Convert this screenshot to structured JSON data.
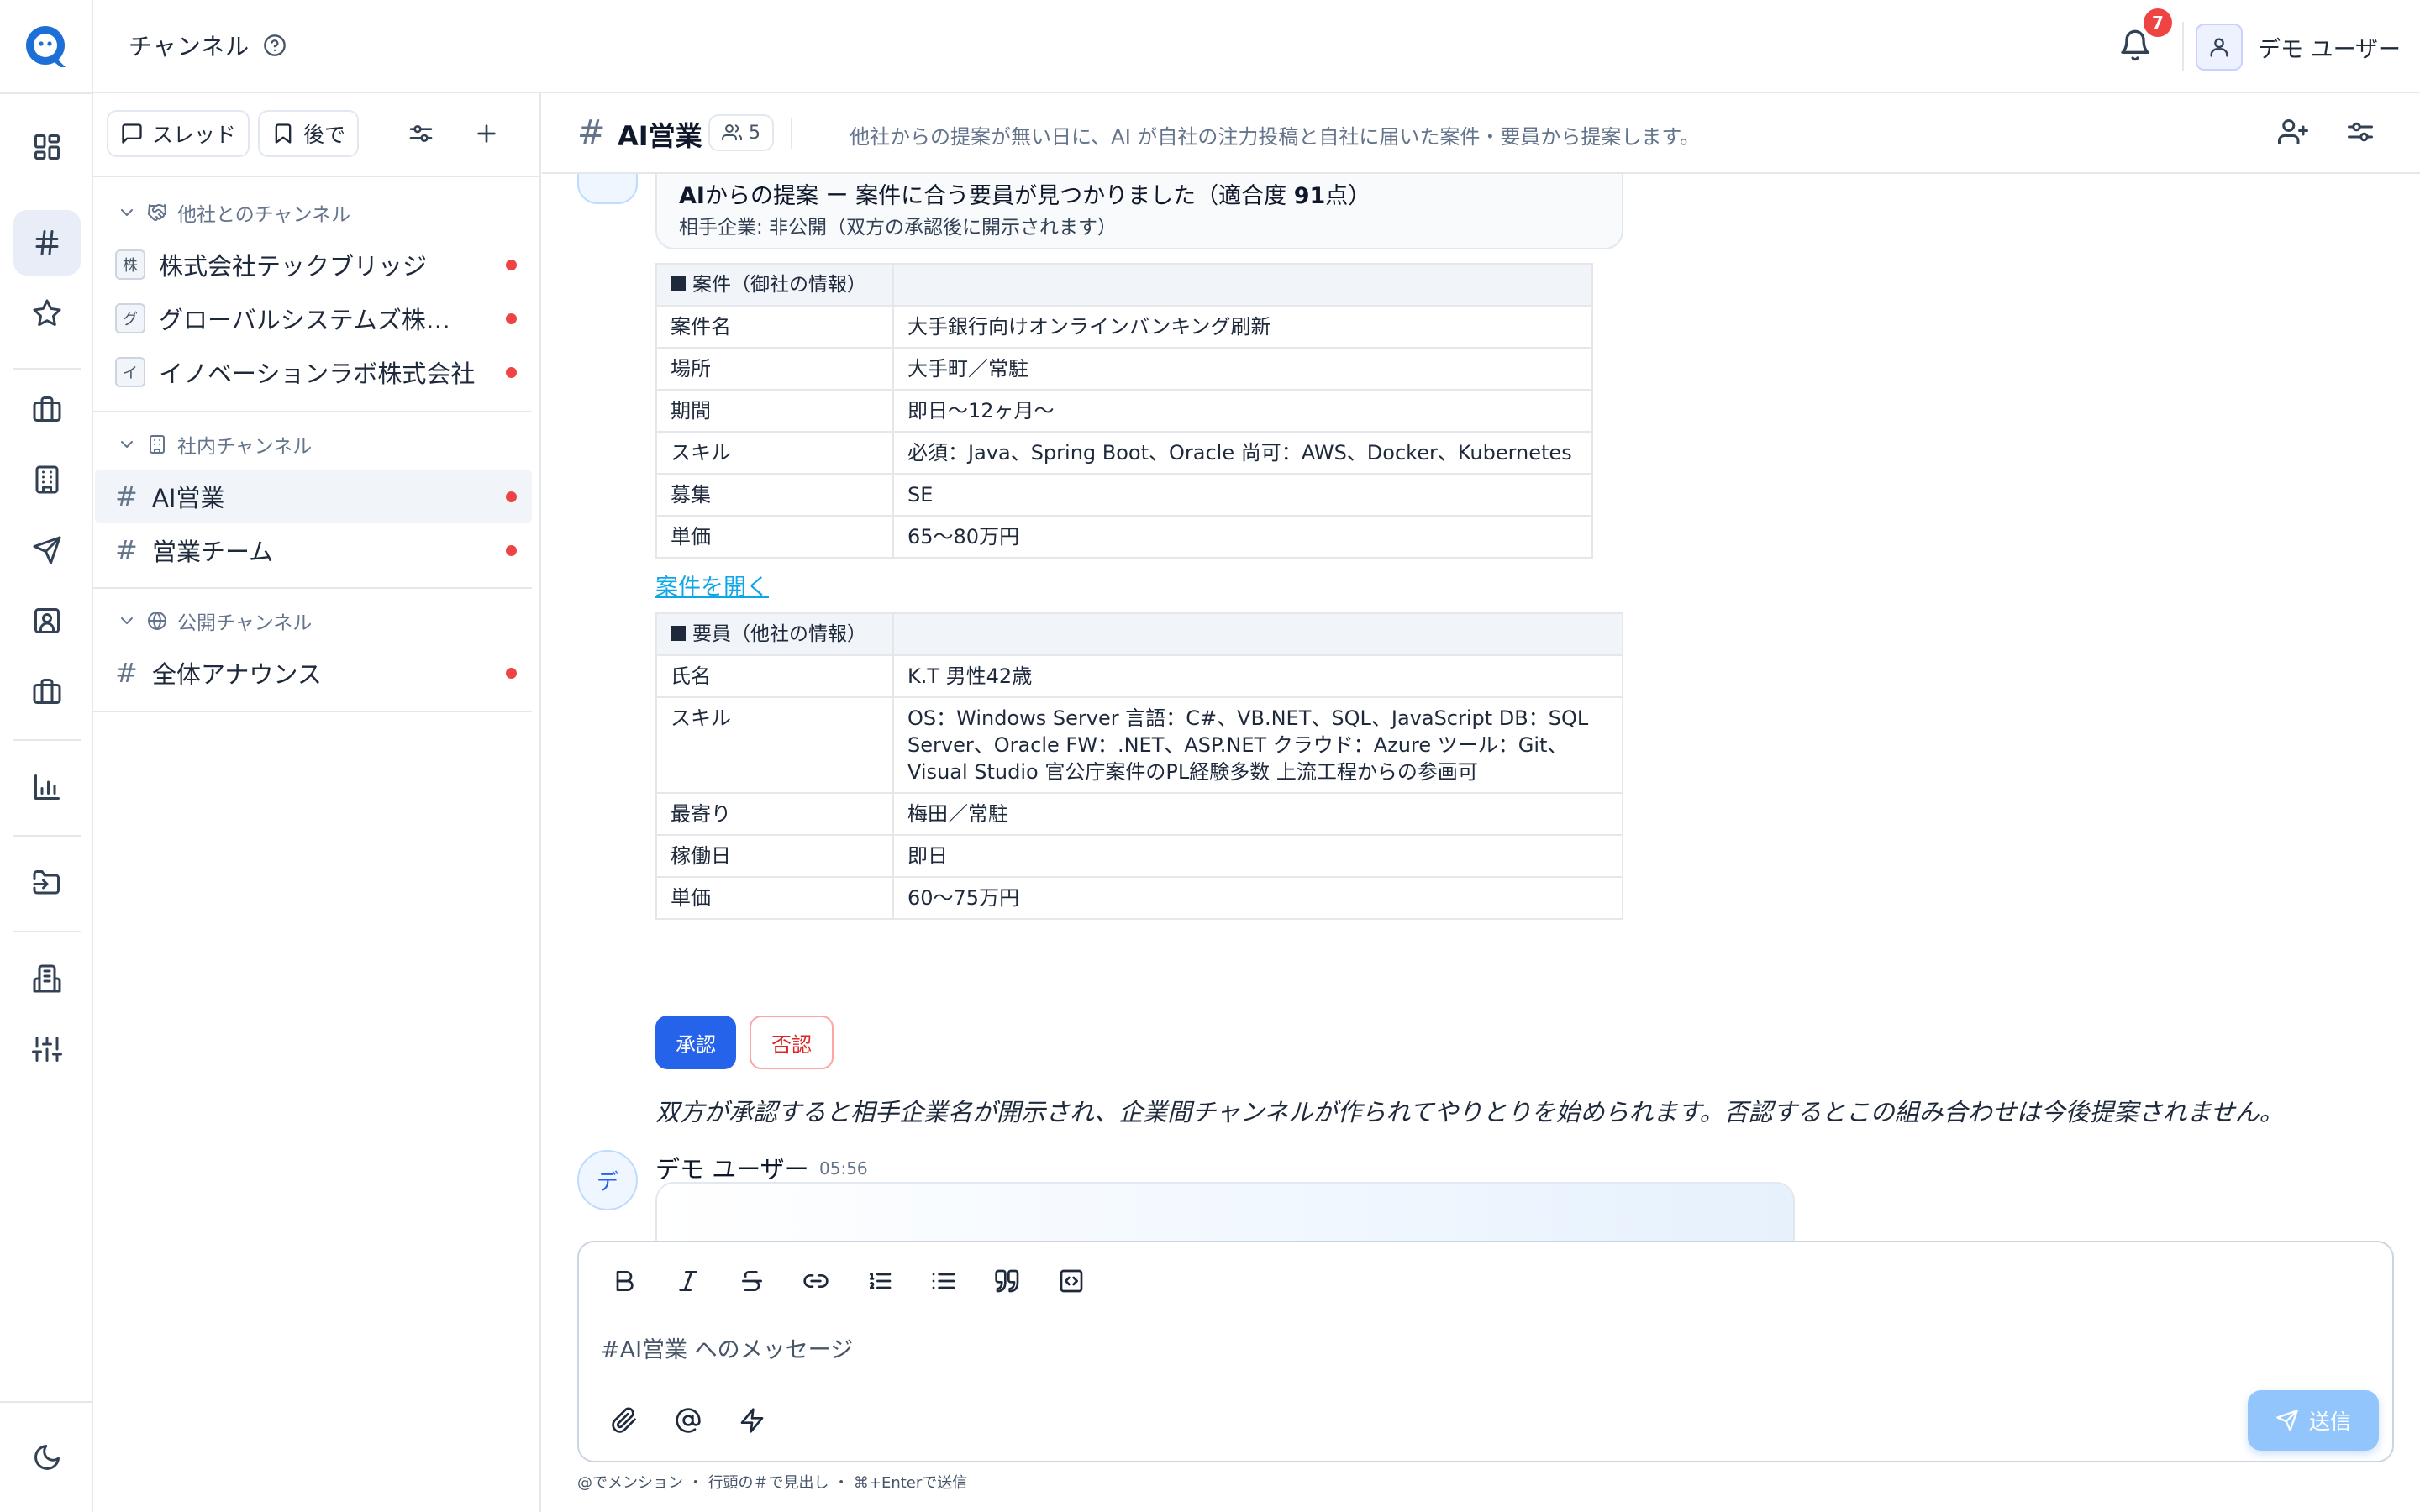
{
  "app": {
    "page_title": "チャンネル",
    "notifications_count": "7",
    "user_name": "デモ ユーザー"
  },
  "sidebar": {
    "thread_button": "スレッド",
    "later_button": "後で",
    "sections": [
      {
        "title": "他社とのチャンネル",
        "channels": [
          {
            "badge": "株",
            "label": "株式会社テックブリッジ",
            "unread": true
          },
          {
            "badge": "グ",
            "label": "グローバルシステムズ株式会社",
            "unread": true
          },
          {
            "badge": "イ",
            "label": "イノベーションラボ株式会社",
            "unread": true
          }
        ]
      },
      {
        "title": "社内チャンネル",
        "channels": [
          {
            "label": "AI営業",
            "unread": true,
            "active": true
          },
          {
            "label": "営業チーム",
            "unread": true
          }
        ]
      },
      {
        "title": "公開チャンネル",
        "channels": [
          {
            "label": "全体アナウンス",
            "unread": true
          }
        ]
      }
    ]
  },
  "channel": {
    "name": "AI営業",
    "member_count": "5",
    "description": "他社からの提案が無い日に、AI が自社の注力投稿と自社に届いた案件・要員から提案します。"
  },
  "ai_message": {
    "banner_prefix": "AI",
    "banner_mid": "からの提案 ー 案件に合う要員が見つかりました（適合度 ",
    "banner_score": "91",
    "banner_suffix": "点）",
    "partner_line": "相手企業: 非公開（双方の承認後に開示されます）",
    "project_table": {
      "header": "案件（御社の情報）",
      "rows": [
        {
          "k": "案件名",
          "v": "大手銀行向けオンラインバンキング刷新"
        },
        {
          "k": "場所",
          "v": "大手町／常駐"
        },
        {
          "k": "期間",
          "v": "即日〜12ヶ月〜"
        },
        {
          "k": "スキル",
          "v": "必須：Java、Spring Boot、Oracle 尚可：AWS、Docker、Kubernetes"
        },
        {
          "k": "募集",
          "v": "SE"
        },
        {
          "k": "単価",
          "v": "65〜80万円"
        }
      ]
    },
    "open_link": "案件を開く",
    "staff_table": {
      "header": "要員（他社の情報）",
      "rows": [
        {
          "k": "氏名",
          "v": "K.T 男性42歳"
        },
        {
          "k": "スキル",
          "v": "OS：Windows Server 言語：C#、VB.NET、SQL、JavaScript DB：SQL Server、Oracle FW：.NET、ASP.NET クラウド：Azure ツール：Git、Visual Studio 官公庁案件のPL経験多数 上流工程からの参画可"
        },
        {
          "k": "最寄り",
          "v": "梅田／常駐"
        },
        {
          "k": "稼働日",
          "v": "即日"
        },
        {
          "k": "単価",
          "v": "60〜75万円"
        }
      ]
    },
    "approve_label": "承認",
    "reject_label": "否認",
    "note": "双方が承認すると相手企業名が開示され、企業間チャンネルが作られてやりとりを始められます。否認するとこの組み合わせは今後提案されません。"
  },
  "next_message": {
    "avatar": "デ",
    "author": "デモ ユーザー",
    "time": "05:56"
  },
  "composer": {
    "placeholder": "#AI営業 へのメッセージ",
    "send_label": "送信",
    "hint": "@でメンション ・ 行頭の＃で見出し ・ ⌘+Enterで送信"
  },
  "colors": {
    "accent": "#2563eb",
    "unread_dot": "#ef4444",
    "send_disabled": "#93c5fd",
    "link": "#0ea5e9"
  }
}
